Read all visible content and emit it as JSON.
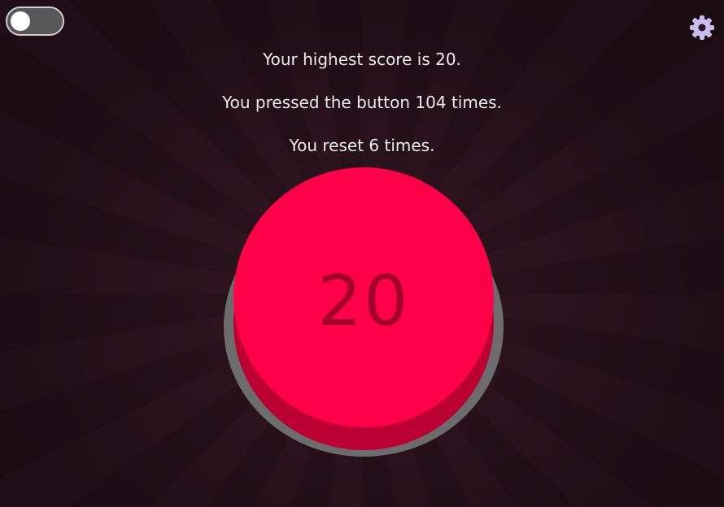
{
  "app": {
    "accent_color": "#ff0049",
    "button_shadow_color": "#bb0033",
    "background_color": "#2a151d"
  },
  "controls": {
    "toggle_state": "off",
    "settings_icon": "gear-icon"
  },
  "stats": {
    "highest_score_text": "Your highest score is 20.",
    "presses_text": "You pressed the button 104 times.",
    "resets_text": "You reset 6 times."
  },
  "button": {
    "value": "20"
  }
}
